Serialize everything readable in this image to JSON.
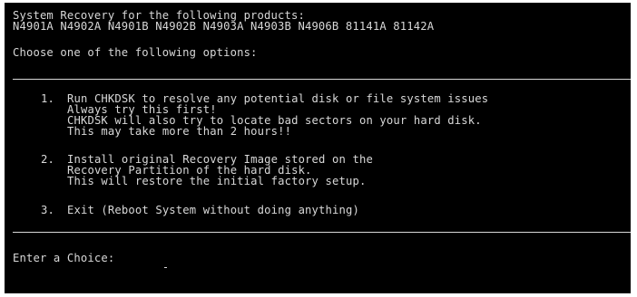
{
  "header": {
    "title": "System Recovery for the following products:",
    "products": "N4901A N4902A N4901B N4902B N4903A N4903B N4906B 81141A 81142A"
  },
  "prompt_choose": "Choose one of the following options:",
  "options": [
    {
      "number": "1.",
      "lines": [
        "Run CHKDSK to resolve any potential disk or file system issues",
        "Always try this first!",
        "CHKDSK will also try to locate bad sectors on your hard disk.",
        "This may take more than 2 hours!!"
      ]
    },
    {
      "number": "2.",
      "lines": [
        "Install original Recovery Image stored on the",
        "Recovery Partition of the hard disk.",
        "This will restore the initial factory setup."
      ]
    },
    {
      "number": "3.",
      "lines": [
        "Exit (Reboot System without doing anything)"
      ]
    }
  ],
  "input": {
    "prompt": "Enter a Choice:",
    "value": ""
  },
  "colors": {
    "background": "#000000",
    "text": "#d8d8d8"
  }
}
